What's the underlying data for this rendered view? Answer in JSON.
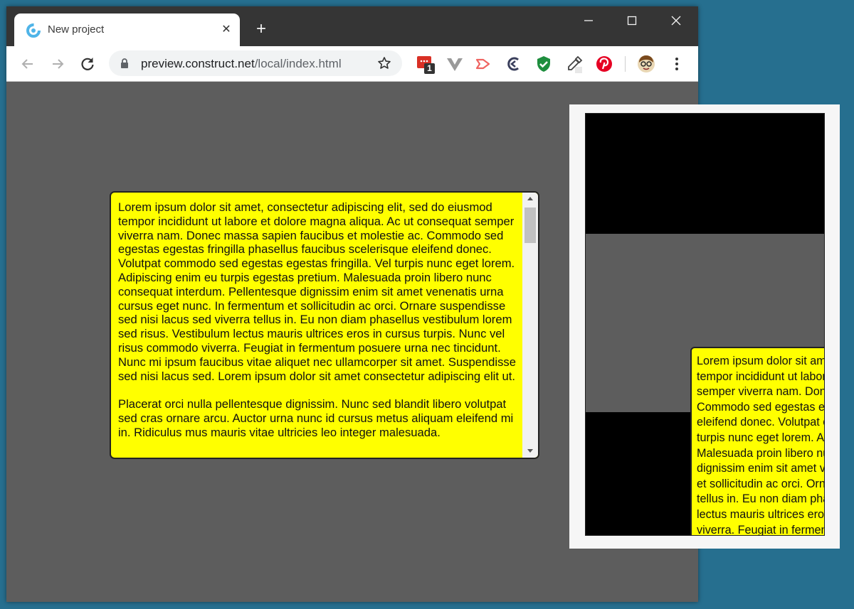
{
  "browser": {
    "tab_title": "New project",
    "tab_close": "✕",
    "new_tab": "+",
    "url_host": "preview.construct.net",
    "url_path": "/local/index.html",
    "extension_badge": "1",
    "colors": {
      "accent": "#266f8f",
      "titlebar": "#353535",
      "viewport": "#5d5d5d"
    }
  },
  "textbox": {
    "color": "#ffff00",
    "paragraphs": [
      "Lorem ipsum dolor sit amet, consectetur adipiscing elit, sed do eiusmod tempor incididunt ut labore et dolore magna aliqua. Ac ut consequat semper viverra nam. Donec massa sapien faucibus et molestie ac. Commodo sed egestas egestas fringilla phasellus faucibus scelerisque eleifend donec. Volutpat commodo sed egestas egestas fringilla. Vel turpis nunc eget lorem. Adipiscing enim eu turpis egestas pretium. Malesuada proin libero nunc consequat interdum. Pellentesque dignissim enim sit amet venenatis urna cursus eget nunc. In fermentum et sollicitudin ac orci. Ornare suspendisse sed nisi lacus sed viverra tellus in. Eu non diam phasellus vestibulum lorem sed risus. Vestibulum lectus mauris ultrices eros in cursus turpis. Nunc vel risus commodo viverra. Feugiat in fermentum posuere urna nec tincidunt. Nunc mi ipsum faucibus vitae aliquet nec ullamcorper sit amet. Suspendisse sed nisi lacus sed. Lorem ipsum dolor sit amet consectetur adipiscing elit ut.",
      "Placerat orci nulla pellentesque dignissim. Nunc sed blandit libero volutpat sed cras ornare arcu. Auctor urna nunc id cursus metus aliquam eleifend mi in. Ridiculus mus mauris vitae ultricies leo integer malesuada."
    ]
  },
  "mobile_preview": {
    "lines": [
      "Lorem ipsum dolor sit amet,",
      "tempor incididunt ut labore",
      "semper viverra nam. Donec",
      "Commodo sed egestas egestas",
      "eleifend donec. Volutpat commodo",
      "turpis nunc eget lorem. Adipiscing",
      "Malesuada proin libero nunc",
      "dignissim enim sit amet venenatis",
      "et sollicitudin ac orci. Ornare",
      "tellus in. Eu non diam phasellus",
      "lectus mauris ultrices eros in",
      "viverra. Feugiat in fermentum"
    ]
  }
}
